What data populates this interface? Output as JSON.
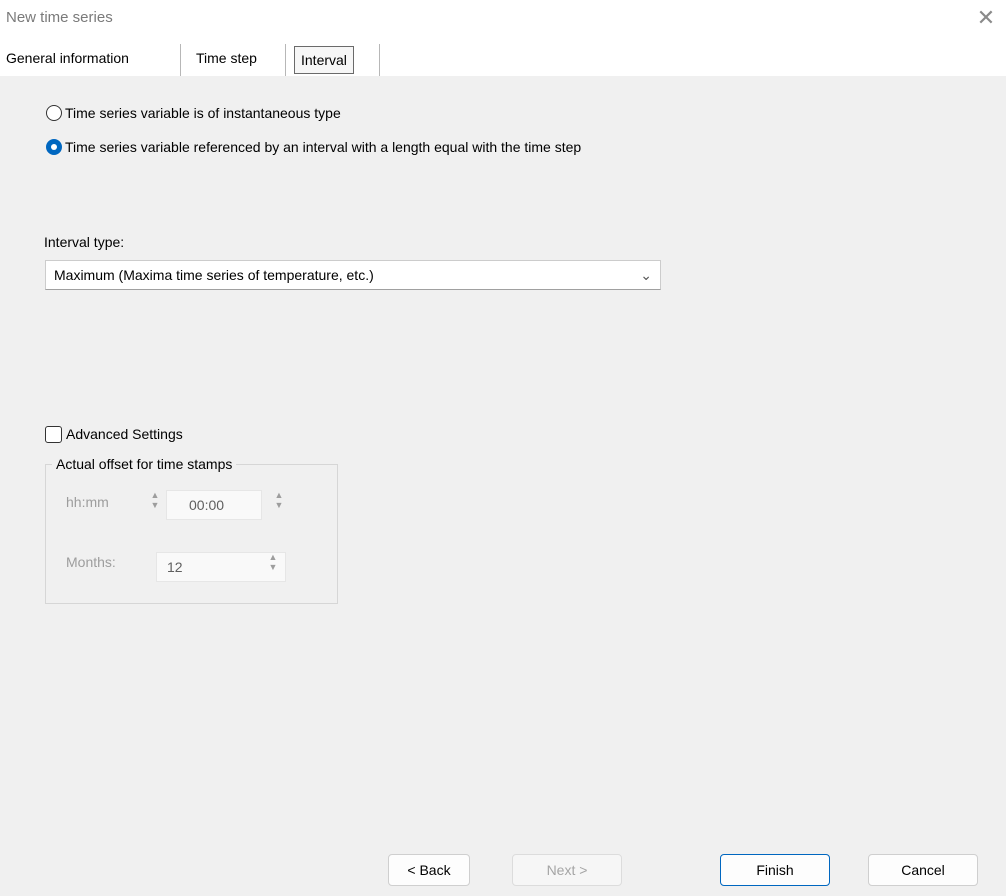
{
  "window": {
    "title": "New time series",
    "close_glyph": "✕"
  },
  "tabs": [
    {
      "label": "General information",
      "active": false
    },
    {
      "label": "Time step",
      "active": false
    },
    {
      "label": "Interval",
      "active": true
    }
  ],
  "variable_type": {
    "options": [
      {
        "label": "Time series variable is of instantaneous type",
        "checked": false
      },
      {
        "label": "Time series variable referenced by an interval with a length equal with the time step",
        "checked": true
      }
    ]
  },
  "interval": {
    "label": "Interval type:",
    "selected": "Maximum  (Maxima time series of temperature, etc.)",
    "chevron": "chevron-down-icon"
  },
  "advanced": {
    "checkbox_label": "Advanced Settings",
    "checked": false,
    "group_title": "Actual offset for time stamps",
    "hhmm_label": "hh:mm",
    "hhmm_value": "00:00",
    "months_label": "Months:",
    "months_value": "12"
  },
  "buttons": {
    "back": "< Back",
    "next": "Next >",
    "finish": "Finish",
    "cancel": "Cancel"
  },
  "colors": {
    "accent": "#0067c0",
    "dialog_bg": "#f0f0f0",
    "disabled_text": "#9d9d9d"
  }
}
